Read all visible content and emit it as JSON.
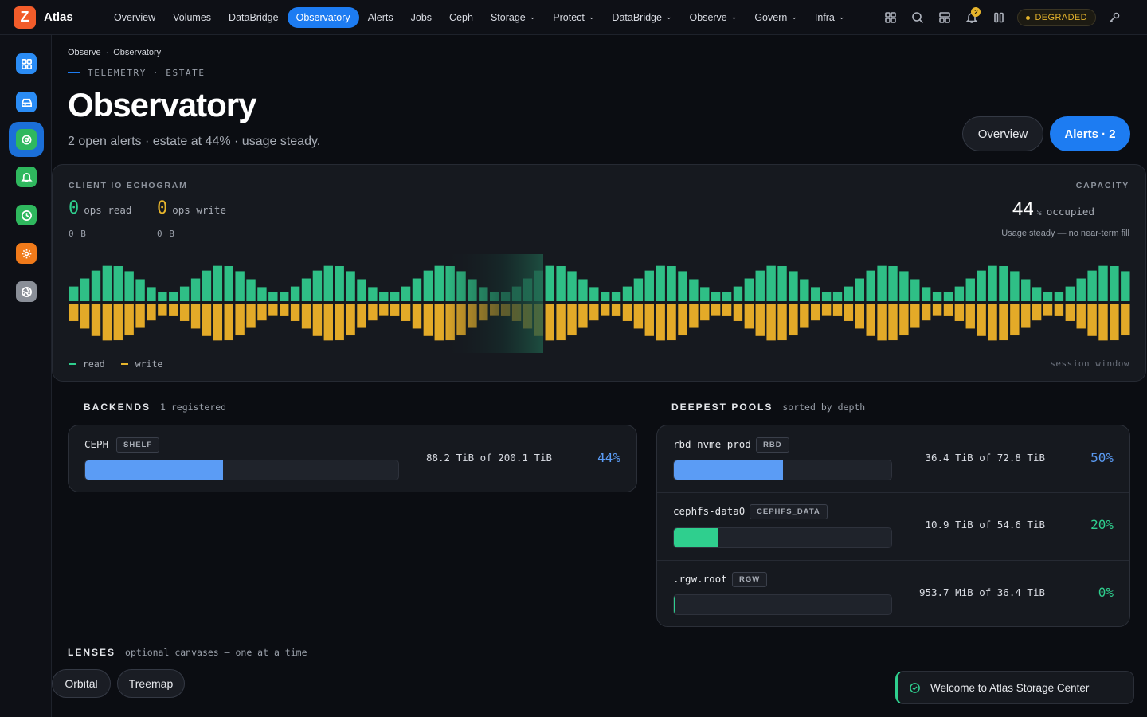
{
  "app": {
    "logo_letter": "Z",
    "name": "Atlas"
  },
  "nav": [
    {
      "label": "Overview",
      "dropdown": false
    },
    {
      "label": "Volumes",
      "dropdown": false
    },
    {
      "label": "DataBridge",
      "dropdown": false
    },
    {
      "label": "Observatory",
      "dropdown": false,
      "active": true
    },
    {
      "label": "Alerts",
      "dropdown": false
    },
    {
      "label": "Jobs",
      "dropdown": false
    },
    {
      "label": "Ceph",
      "dropdown": false
    },
    {
      "label": "Storage",
      "dropdown": true
    },
    {
      "label": "Protect",
      "dropdown": true
    },
    {
      "label": "DataBridge",
      "dropdown": true
    },
    {
      "label": "Observe",
      "dropdown": true
    },
    {
      "label": "Govern",
      "dropdown": true
    },
    {
      "label": "Infra",
      "dropdown": true
    }
  ],
  "tools": {
    "icons": [
      "grid-icon",
      "search-icon",
      "layout-icon",
      "bell-icon",
      "columns-icon",
      "key-icon"
    ],
    "notification_count": "2",
    "status_label": "DEGRADED",
    "status_color": "#e7b52c"
  },
  "sidebar": {
    "items": [
      {
        "icon": "dashboard-icon",
        "color": "#2a8cf5"
      },
      {
        "icon": "drive-icon",
        "color": "#2a8cf5"
      },
      {
        "icon": "radar-icon",
        "color": "#2fb85e",
        "active": true
      },
      {
        "icon": "bell-icon",
        "color": "#2fb85e"
      },
      {
        "icon": "clock-icon",
        "color": "#2fb85e"
      },
      {
        "icon": "gear-icon",
        "color": "#f07a1a"
      },
      {
        "icon": "aperture-icon",
        "color": "#8a8f98"
      }
    ]
  },
  "breadcrumb": [
    "Observe",
    "Observatory"
  ],
  "eyebrow": [
    "TELEMETRY",
    "ESTATE"
  ],
  "page": {
    "title": "Observatory",
    "subtitle": "2 open alerts · estate at 44% · usage steady."
  },
  "header_buttons": {
    "overview": "Overview",
    "alerts": "Alerts · 2"
  },
  "echogram": {
    "label": "CLIENT IO ECHOGRAM",
    "read_value": "0",
    "read_unit": "ops read",
    "read_bytes": "0 B",
    "write_value": "0",
    "write_unit": "ops write",
    "write_bytes": "0 B",
    "capacity_label": "CAPACITY",
    "capacity_value": "44",
    "capacity_unit": "%",
    "capacity_word": "occupied",
    "capacity_note": "Usage steady — no near-term fill",
    "legend_read": "read",
    "legend_write": "write",
    "session_label": "session window",
    "read_color": "#2fbf86",
    "write_color": "#e3aa28"
  },
  "backends": {
    "title": "BACKENDS",
    "subtitle": "1 registered",
    "rows": [
      {
        "name": "CEPH",
        "tag": "SHELF",
        "amount": "88.2 TiB of 200.1 TiB",
        "pct": "44%",
        "fraction": 0.44,
        "color": "#5b9cf5"
      }
    ]
  },
  "pools": {
    "title": "DEEPEST POOLS",
    "subtitle": "sorted by depth",
    "rows": [
      {
        "name": "rbd-nvme-prod",
        "tag": "RBD",
        "amount": "36.4 TiB of 72.8 TiB",
        "pct": "50%",
        "fraction": 0.5,
        "color": "#5b9cf5"
      },
      {
        "name": "cephfs-data0",
        "tag": "CEPHFS_DATA",
        "amount": "10.9 TiB of 54.6 TiB",
        "pct": "20%",
        "fraction": 0.2,
        "color": "#2fcf8e"
      },
      {
        "name": ".rgw.root",
        "tag": "RGW",
        "amount": "953.7 MiB of 36.4 TiB",
        "pct": "0%",
        "fraction": 0.0,
        "color": "#2fcf8e"
      }
    ]
  },
  "lenses": {
    "title": "LENSES",
    "subtitle": "optional canvases — one at a time",
    "buttons": [
      "Orbital",
      "Treemap"
    ]
  },
  "toast": {
    "message": "Welcome to Atlas Storage Center"
  }
}
